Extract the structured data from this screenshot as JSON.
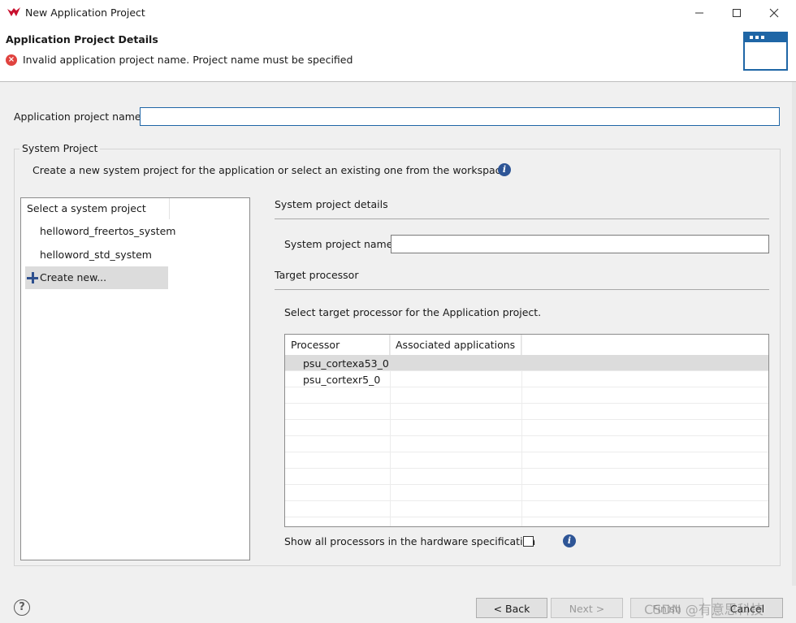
{
  "window": {
    "title": "New Application Project"
  },
  "header": {
    "title": "Application Project Details",
    "message": "Invalid application project name. Project name must be specified"
  },
  "form": {
    "app_name_label": "Application project name:",
    "app_name_value": ""
  },
  "system_project": {
    "legend": "System Project",
    "description": "Create a new system project for the application or select an existing one from the workspace",
    "list_header": "Select a system project",
    "items": [
      {
        "label": "helloword_freertos_system"
      },
      {
        "label": "helloword_std_system"
      },
      {
        "label": "Create new..."
      }
    ],
    "selected_item": "Create new..."
  },
  "details": {
    "section_title": "System project details",
    "name_label": "System project name:",
    "name_value": "",
    "target_title": "Target processor",
    "target_desc": "Select target processor for the Application project.",
    "columns": [
      "Processor",
      "Associated applications"
    ],
    "rows": [
      {
        "processor": "psu_cortexa53_0",
        "apps": ""
      },
      {
        "processor": "psu_cortexr5_0",
        "apps": ""
      }
    ],
    "selected_row": "psu_cortexa53_0",
    "show_all_label": "Show all processors in the hardware specification",
    "show_all_checked": false
  },
  "buttons": {
    "back": "< Back",
    "next": "Next >",
    "finish": "Finish",
    "cancel": "Cancel"
  },
  "watermark": "CSDN @有意思科技",
  "colors": {
    "accent": "#1f66a6",
    "error": "#e0433f",
    "info": "#2e5596",
    "selection": "#dcdcdc",
    "logo_red": "#c8102e"
  },
  "icons": [
    "app-logo",
    "minimize-icon",
    "maximize-icon",
    "close-icon",
    "error-icon",
    "wizard-banner-icon",
    "info-icon",
    "plus-icon",
    "help-icon",
    "checkbox"
  ]
}
